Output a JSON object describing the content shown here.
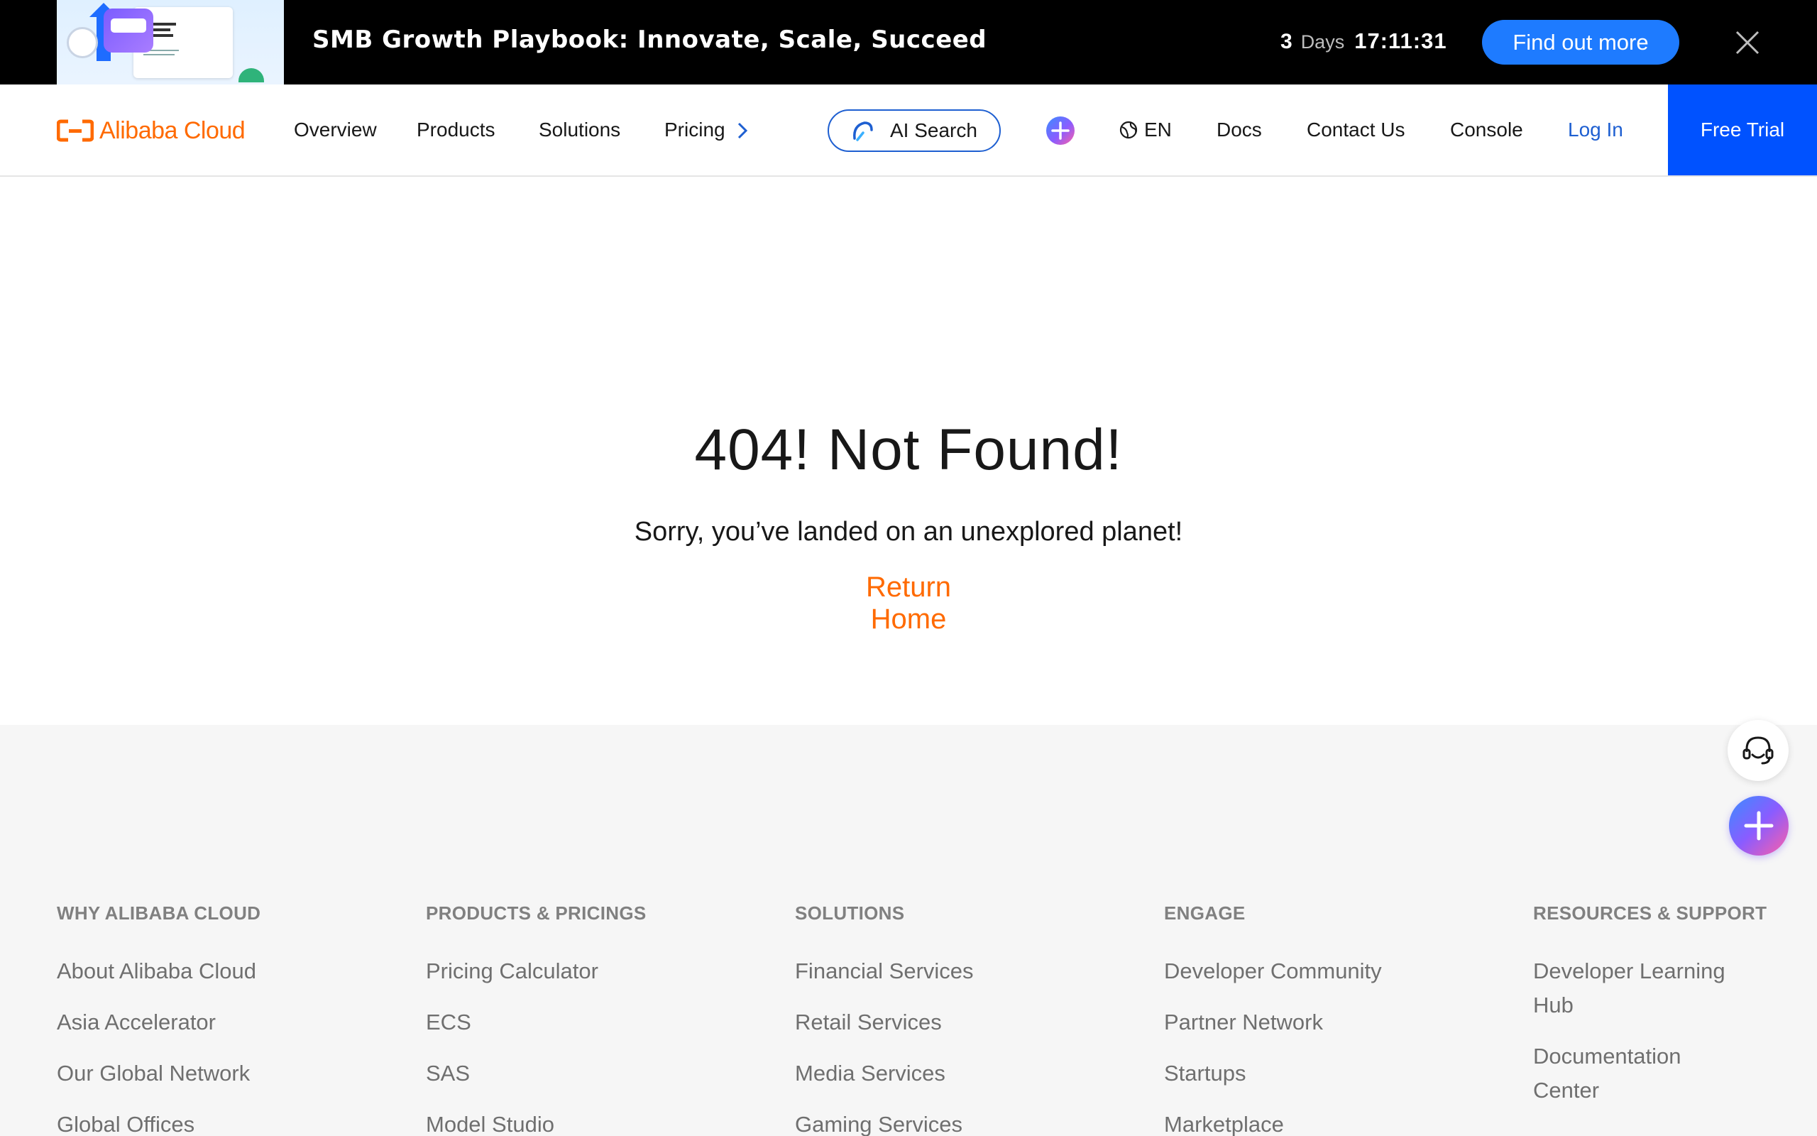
{
  "promo": {
    "title": "SMB Growth Playbook: Innovate, Scale, Succeed",
    "thumbnail_label": "The SMB Growth Playbook",
    "countdown": {
      "days": "3",
      "days_label": "Days",
      "time": "17:11:31"
    },
    "cta_label": "Find out more",
    "close_icon": "close-icon"
  },
  "nav": {
    "logo_text": "Alibaba Cloud",
    "items": [
      {
        "label": "Overview"
      },
      {
        "label": "Products"
      },
      {
        "label": "Solutions"
      },
      {
        "label": "Pricing"
      }
    ],
    "ai_search_label": "AI Search",
    "language": "EN",
    "links": [
      {
        "label": "Docs"
      },
      {
        "label": "Contact Us"
      },
      {
        "label": "Console"
      }
    ],
    "login_label": "Log In",
    "free_trial_label": "Free Trial",
    "accent_color": "#ff6a00",
    "primary_color": "#0052ff"
  },
  "main": {
    "title": "404! Not Found!",
    "subtitle": "Sorry, you’ve landed on an unexplored planet!",
    "return_label": "Return Home"
  },
  "footer": {
    "columns": [
      {
        "heading": "WHY ALIBABA CLOUD",
        "links": [
          "About Alibaba Cloud",
          "Asia Accelerator",
          "Our Global Network",
          "Global Offices"
        ]
      },
      {
        "heading": "PRODUCTS & PRICINGS",
        "links": [
          "Pricing Calculator",
          "ECS",
          "SAS",
          "Model Studio"
        ]
      },
      {
        "heading": "SOLUTIONS",
        "links": [
          "Financial Services",
          "Retail Services",
          "Media Services",
          "Gaming Services"
        ]
      },
      {
        "heading": "ENGAGE",
        "links": [
          "Developer Community",
          "Partner Network",
          "Startups",
          "Marketplace"
        ]
      },
      {
        "heading": "RESOURCES & SUPPORT",
        "links": [
          "Developer Learning",
          "Hub",
          "Documentation",
          "Center"
        ]
      }
    ]
  },
  "floating": {
    "support_icon": "headset-icon",
    "ai_icon": "ai-sparkle-icon"
  }
}
